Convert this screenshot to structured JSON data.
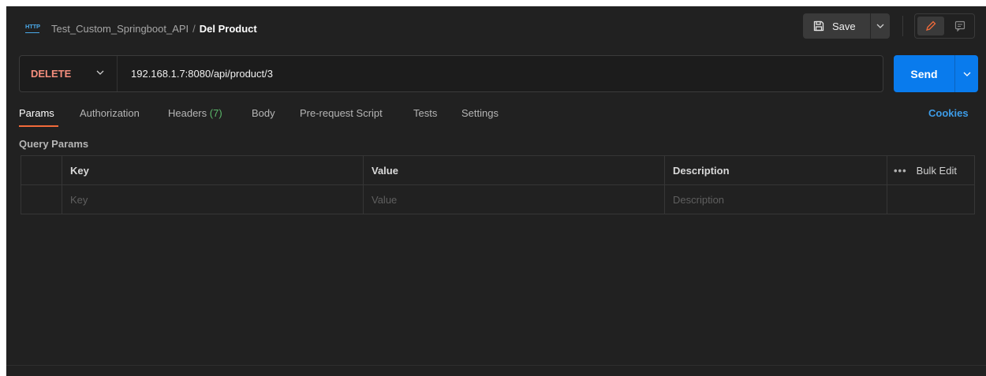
{
  "header": {
    "protocol_badge": "HTTP",
    "collection": "Test_Custom_Springboot_API",
    "separator": "/",
    "request_name": "Del Product",
    "save_label": "Save"
  },
  "request": {
    "method": "DELETE",
    "url": "192.168.1.7:8080/api/product/3",
    "send_label": "Send"
  },
  "tabs": [
    {
      "label": "Params",
      "active": true
    },
    {
      "label": "Authorization"
    },
    {
      "label": "Headers",
      "count": "(7)"
    },
    {
      "label": "Body"
    },
    {
      "label": "Pre-request Script"
    },
    {
      "label": "Tests"
    },
    {
      "label": "Settings"
    }
  ],
  "cookies_label": "Cookies",
  "query_params": {
    "title": "Query Params",
    "columns": {
      "key": "Key",
      "value": "Value",
      "description": "Description"
    },
    "bulk_edit_label": "Bulk Edit",
    "more_label": "•••",
    "placeholders": {
      "key": "Key",
      "value": "Value",
      "description": "Description"
    }
  },
  "colors": {
    "background": "#212121",
    "method_delete": "#f58e7d",
    "send_button": "#097bed",
    "active_tab_underline": "#f26b3a",
    "count_green": "#5bb86a",
    "link_blue": "#3d9ce8"
  }
}
